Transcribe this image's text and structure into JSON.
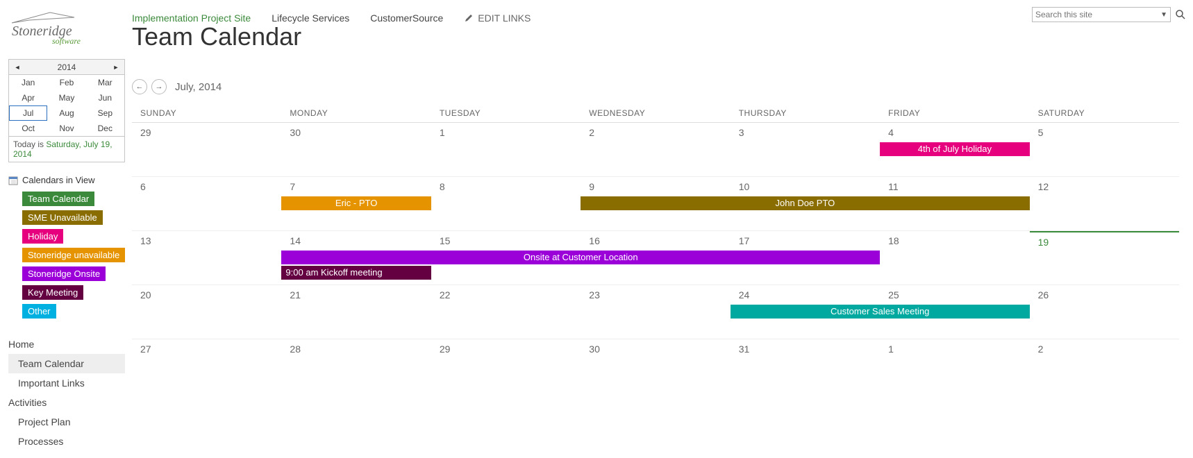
{
  "header": {
    "nav": {
      "implementation": "Implementation Project Site",
      "lifecycle": "Lifecycle Services",
      "customersource": "CustomerSource",
      "edit_links": "EDIT LINKS"
    },
    "page_title": "Team Calendar",
    "search_placeholder": "Search this site"
  },
  "mini_cal": {
    "year": "2014",
    "months": [
      "Jan",
      "Feb",
      "Mar",
      "Apr",
      "May",
      "Jun",
      "Jul",
      "Aug",
      "Sep",
      "Oct",
      "Nov",
      "Dec"
    ],
    "selected": "Jul",
    "today_prefix": "Today is ",
    "today": "Saturday, July 19, 2014"
  },
  "legends": {
    "heading": "Calendars in View",
    "items": [
      {
        "label": "Team Calendar",
        "color": "#3b8a3b"
      },
      {
        "label": "SME Unavailable",
        "color": "#8a6d00"
      },
      {
        "label": "Holiday",
        "color": "#e6007e"
      },
      {
        "label": "Stoneridge unavailable",
        "color": "#e59400"
      },
      {
        "label": "Stoneridge Onsite",
        "color": "#9b00d9"
      },
      {
        "label": "Key Meeting",
        "color": "#640041"
      },
      {
        "label": "Other",
        "color": "#00b0e0"
      }
    ]
  },
  "left_nav": {
    "home": "Home",
    "team_calendar": "Team Calendar",
    "important_links": "Important Links",
    "activities": "Activities",
    "project_plan": "Project Plan",
    "processes": "Processes"
  },
  "calendar": {
    "title": "July, 2014",
    "days": [
      "SUNDAY",
      "MONDAY",
      "TUESDAY",
      "WEDNESDAY",
      "THURSDAY",
      "FRIDAY",
      "SATURDAY"
    ],
    "weeks": [
      [
        "29",
        "30",
        "1",
        "2",
        "3",
        "4",
        "5"
      ],
      [
        "6",
        "7",
        "8",
        "9",
        "10",
        "11",
        "12"
      ],
      [
        "13",
        "14",
        "15",
        "16",
        "17",
        "18",
        "19"
      ],
      [
        "20",
        "21",
        "22",
        "23",
        "24",
        "25",
        "26"
      ],
      [
        "27",
        "28",
        "29",
        "30",
        "31",
        "1",
        "2"
      ]
    ],
    "today": {
      "week": 2,
      "col": 6
    },
    "events": [
      {
        "week": 0,
        "start": 5,
        "span": 1,
        "row": 0,
        "cls": "pink",
        "label": "4th of July Holiday"
      },
      {
        "week": 1,
        "start": 1,
        "span": 1,
        "row": 0,
        "cls": "orange",
        "label": "Eric - PTO"
      },
      {
        "week": 1,
        "start": 3,
        "span": 3,
        "row": 0,
        "cls": "brown",
        "label": "John Doe PTO"
      },
      {
        "week": 2,
        "start": 1,
        "span": 4,
        "row": 0,
        "cls": "purple",
        "label": "Onsite at Customer Location"
      },
      {
        "week": 2,
        "start": 1,
        "span": 1,
        "row": 1,
        "cls": "maroon",
        "label": "9:00 am Kickoff meeting",
        "align": "left"
      },
      {
        "week": 3,
        "start": 4,
        "span": 2,
        "row": 0,
        "cls": "teal",
        "label": "Customer Sales Meeting"
      }
    ]
  }
}
